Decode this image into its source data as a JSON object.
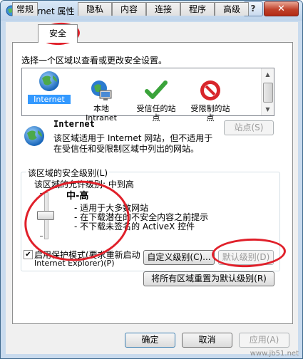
{
  "window": {
    "title": "Internet 属性",
    "help_label": "?",
    "close_label": "✕"
  },
  "tabs": [
    {
      "label": "常规"
    },
    {
      "label": "安全"
    },
    {
      "label": "隐私"
    },
    {
      "label": "内容"
    },
    {
      "label": "连接"
    },
    {
      "label": "程序"
    },
    {
      "label": "高级"
    }
  ],
  "active_tab": "安全",
  "security": {
    "select_zone_text": "选择一个区域以查看或更改安全设置。",
    "zones": [
      {
        "label": "Internet",
        "icon": "globe-icon",
        "selected": true
      },
      {
        "label": "本地\nIntranet",
        "icon": "local-intranet-icon"
      },
      {
        "label": "受信任的站\n点",
        "icon": "trusted-sites-icon"
      },
      {
        "label": "受限制的站\n点",
        "icon": "restricted-sites-icon"
      }
    ],
    "zone_title": "Internet",
    "zone_desc_line1": "该区域适用于 Internet 网站，但不适用于",
    "zone_desc_line2": "在受信任和受限制区域中列出的网站。",
    "sites_button": "站点(S)",
    "level_group_label": "该区域的安全级别(L)",
    "allowed_levels_label": "该区域的允许级别: 中到高",
    "level_name": "中-高",
    "level_points": [
      "- 适用于大多数网站",
      "- 在下载潜在的不安全内容之前提示",
      "- 不下载未签名的 ActiveX 控件"
    ],
    "slider_level_fraction": 0.5,
    "protected_mode_label_line1": "启用保护模式(要求重新启动",
    "protected_mode_label_line2": "Internet Explorer)(P)",
    "protected_mode_checked": true,
    "custom_level_button": "自定义级别(C)...",
    "default_level_button": "默认级别(D)",
    "reset_all_button": "将所有区域重置为默认级别(R)"
  },
  "footer": {
    "ok": "确定",
    "cancel": "取消",
    "apply": "应用(A)"
  },
  "watermark": "www.jb51.net",
  "colors": {
    "annotation": "#e0202a",
    "selection": "#3399ff"
  }
}
